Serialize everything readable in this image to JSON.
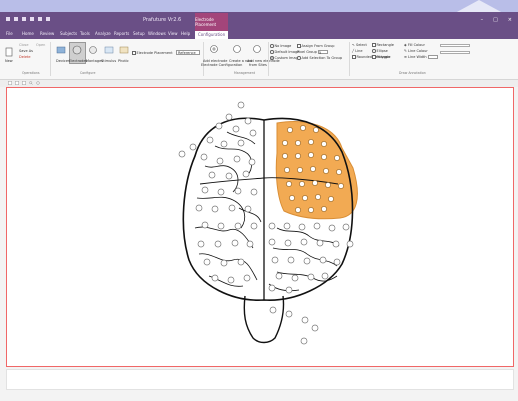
{
  "window": {
    "app_title": "Prafuture Vr2.6",
    "context_title": "Electrode Placement",
    "controls": [
      "–",
      "□",
      "×"
    ]
  },
  "ribbon": {
    "tabs": [
      {
        "label": "File",
        "active": false
      },
      {
        "label": "Home",
        "active": false
      },
      {
        "label": "Review",
        "active": false
      },
      {
        "label": "Subjects",
        "active": false
      },
      {
        "label": "Tools",
        "active": false
      },
      {
        "label": "Analyze",
        "active": false
      },
      {
        "label": "Reports",
        "active": false
      },
      {
        "label": "Setup",
        "active": false
      },
      {
        "label": "Windows",
        "active": false
      },
      {
        "label": "View",
        "active": false
      },
      {
        "label": "Help",
        "active": false
      },
      {
        "label": "Configuration",
        "active": true
      }
    ],
    "operations": {
      "new": "New",
      "save_as": "Save As",
      "delete": "Delete",
      "close": "Close",
      "open": "Open",
      "label": "Operations"
    },
    "configure": {
      "devices": "Devices",
      "electrodes": "Electrodes",
      "montages": "Montages",
      "stimulus": "Stimulus",
      "photic": "Photic",
      "label": "Configure"
    },
    "background_montage": {
      "checkbox": "Electrode Placement",
      "value": "Reference"
    },
    "actions": {
      "add_electrode": "Add electrode",
      "create_new": "Create a new",
      "add_new_electrode": "Add new electrode",
      "from_sites": "from Sites",
      "electrode_config": "Electrode Configuration",
      "label": "Management"
    },
    "image": {
      "no_image": "No Image",
      "default_image": "Default Image",
      "custom_image": "Custom Image",
      "assign_from_group": "Assign From Group",
      "pixel_group": "Pixel Group",
      "pixel_value": "5",
      "add_selection": "Add Selection To Group"
    },
    "tools": {
      "select": "Select",
      "line": "Line",
      "rectangle": "Rectangle",
      "ellipse": "Ellipse",
      "polygon": "Polygon",
      "rounded_rectangle": "Rounded Rectangle",
      "fill_colour": "Fill Colour",
      "line_colour": "Line Colour",
      "line_width": "Line Width",
      "label": "Draw Annotation"
    }
  },
  "canvas": {
    "electrode_highlight_color": "#f2a64a",
    "electrode_highlight_border": "#d8892c",
    "outline_color": "#111111",
    "electrode_color": "#777777"
  }
}
